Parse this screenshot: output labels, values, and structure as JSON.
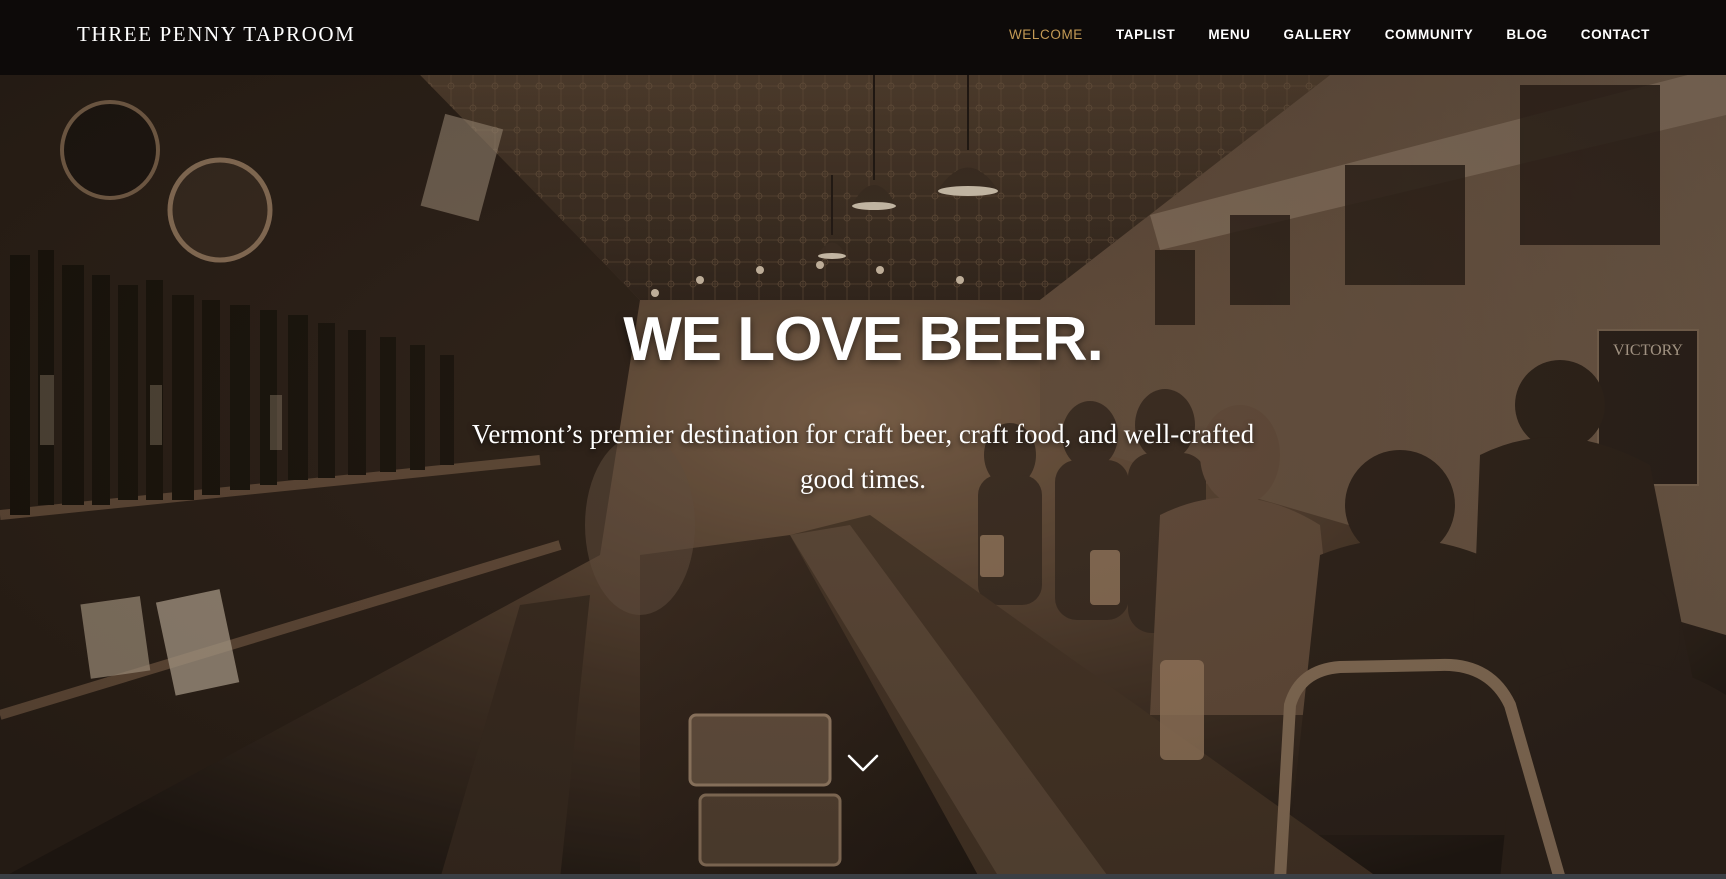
{
  "brand": {
    "name": "THREE PENNY TAPROOM"
  },
  "nav": {
    "items": [
      {
        "label": "WELCOME",
        "active": true
      },
      {
        "label": "TAPLIST",
        "active": false
      },
      {
        "label": "MENU",
        "active": false
      },
      {
        "label": "GALLERY",
        "active": false
      },
      {
        "label": "COMMUNITY",
        "active": false
      },
      {
        "label": "BLOG",
        "active": false
      },
      {
        "label": "CONTACT",
        "active": false
      }
    ]
  },
  "hero": {
    "headline": "WE LOVE BEER.",
    "tagline": "Vermont’s premier destination for craft beer, craft food, and well-crafted good times.",
    "scroll_icon": "chevron-down-icon"
  },
  "colors": {
    "topbar": "#0d0a09",
    "nav_active": "#c39a55",
    "nav_text": "#ffffff",
    "photo_tone": "#6b5240"
  }
}
